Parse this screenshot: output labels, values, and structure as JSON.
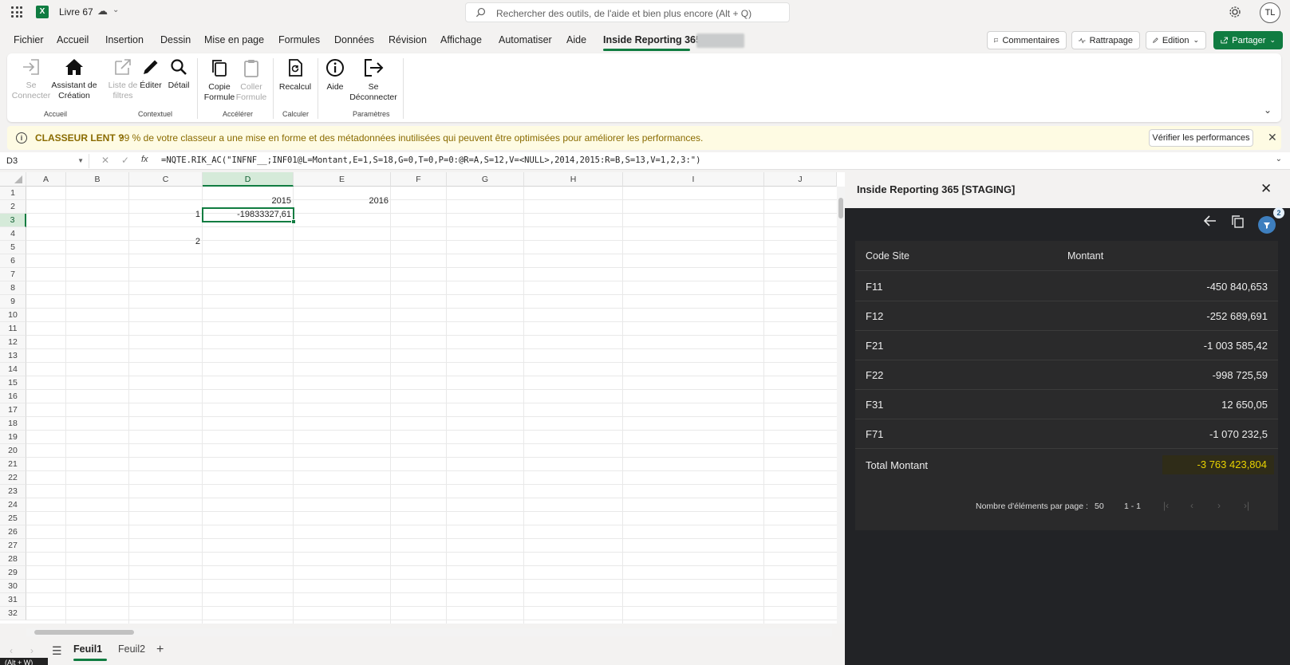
{
  "app": {
    "doc_title": "Livre 67",
    "search_placeholder": "Rechercher des outils, de l'aide et bien plus encore (Alt + Q)",
    "user_initials": "TL",
    "colors": {
      "accent": "#107c41",
      "warning_bg": "#fefbe3",
      "pane_bg": "#222326",
      "total_highlight": "#e8d200"
    }
  },
  "menu": {
    "tabs": [
      "Fichier",
      "Accueil",
      "Insertion",
      "Dessin",
      "Mise en page",
      "Formules",
      "Données",
      "Révision",
      "Affichage",
      "Automatiser",
      "Aide",
      "Inside Reporting 365"
    ],
    "active_tab": "Inside Reporting 365",
    "buttons": {
      "comments": "Commentaires",
      "catchup": "Rattrapage",
      "edition": "Edition",
      "share": "Partager"
    }
  },
  "ribbon": {
    "btn_se_connecter": "Se Connecter",
    "btn_assistant": "Assistant de Création",
    "btn_liste_filtres": "Liste de filtres",
    "btn_editer": "Éditer",
    "btn_detail": "Détail",
    "btn_copie": "Copie Formule",
    "btn_coller": "Coller Formule",
    "btn_recalcul": "Recalcul",
    "btn_aide": "Aide",
    "btn_deconnecter": "Se Déconnecter",
    "grp_accueil": "Accueil",
    "grp_contextuel": "Contextuel",
    "grp_accelerer": "Accélérer",
    "grp_calculer": "Calculer",
    "grp_parametres": "Paramètres"
  },
  "banner": {
    "title": "CLASSEUR LENT ?",
    "message": "99 % de votre classeur a une mise en forme et des métadonnées inutilisées qui peuvent être optimisées pour améliorer les performances.",
    "button": "Vérifier les performances"
  },
  "formula_bar": {
    "name_box": "D3",
    "fx": "fx",
    "formula": "=NQTE.RIK_AC(\"INFNF__;INF01@L=Montant,E=1,S=18,G=0,T=0,P=0:@R=A,S=12,V=<NULL>,2014,2015:R=B,S=13,V=1,2,3:\")"
  },
  "grid": {
    "columns": [
      "A",
      "B",
      "C",
      "D",
      "E",
      "F",
      "G",
      "H",
      "I",
      "J"
    ],
    "rows": [
      "1",
      "2",
      "3",
      "4",
      "5",
      "6",
      "7",
      "8",
      "9",
      "10",
      "11",
      "12",
      "13",
      "14",
      "15",
      "16",
      "17",
      "18",
      "19",
      "20",
      "21",
      "22",
      "23",
      "24",
      "25",
      "26",
      "27",
      "28",
      "29",
      "30",
      "31",
      "32"
    ],
    "selected_col": "D",
    "selected_row": "3",
    "cells": {
      "D2": "2015",
      "E2": "2016",
      "C3": "1",
      "D3": "-19833327,61",
      "C5": "2"
    }
  },
  "sheets": {
    "tabs": [
      "Feuil1",
      "Feuil2"
    ],
    "active": "Feuil1",
    "status_text": "(Alt + W)"
  },
  "pane": {
    "title": "Inside Reporting 365 [STAGING]",
    "filter_badge": "2",
    "table": {
      "headers": [
        "Code Site",
        "Montant"
      ],
      "rows": [
        {
          "site": "F11",
          "montant": "-450 840,653"
        },
        {
          "site": "F12",
          "montant": "-252 689,691"
        },
        {
          "site": "F21",
          "montant": "-1 003 585,42"
        },
        {
          "site": "F22",
          "montant": "-998 725,59"
        },
        {
          "site": "F31",
          "montant": "12 650,05"
        },
        {
          "site": "F71",
          "montant": "-1 070 232,5"
        }
      ],
      "total_label": "Total Montant",
      "total_value": "-3 763 423,804"
    },
    "pager": {
      "label": "Nombre d'éléments par page :",
      "per_page": "50",
      "range": "1 - 1"
    }
  }
}
